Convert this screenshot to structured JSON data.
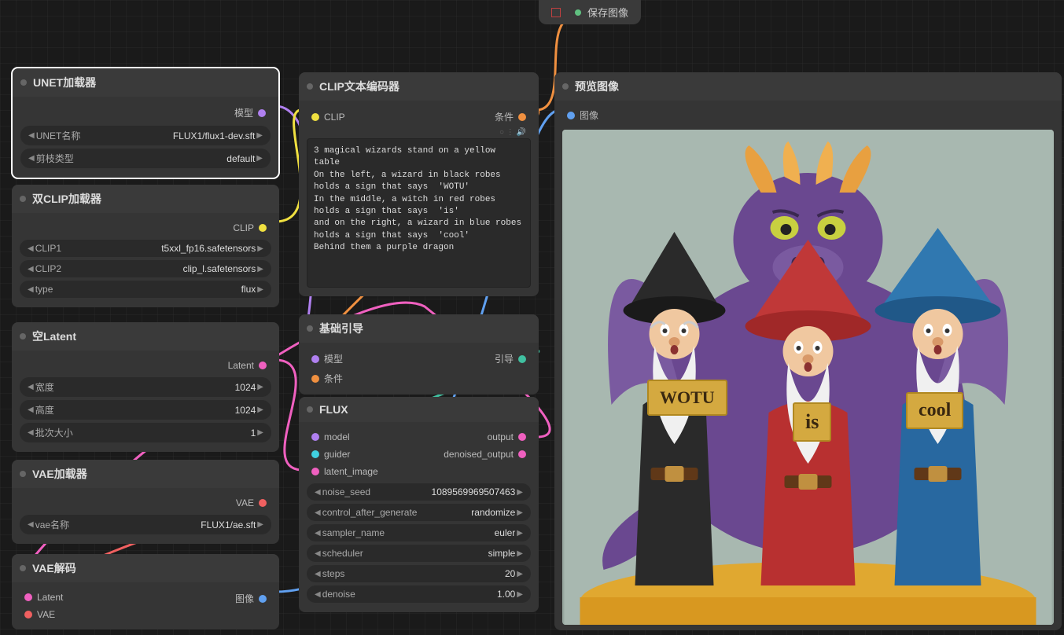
{
  "top_widget": {
    "label": "保存图像"
  },
  "nodes": {
    "unet": {
      "title": "UNET加载器",
      "out_port": "模型",
      "widgets": {
        "unet_name_label": "UNET名称",
        "unet_name_value": "FLUX1/flux1-dev.sft",
        "prune_label": "剪枝类型",
        "prune_value": "default"
      }
    },
    "dualclip": {
      "title": "双CLIP加载器",
      "out_port": "CLIP",
      "widgets": {
        "clip1_label": "CLIP1",
        "clip1_value": "t5xxl_fp16.safetensors",
        "clip2_label": "CLIP2",
        "clip2_value": "clip_l.safetensors",
        "type_label": "type",
        "type_value": "flux"
      }
    },
    "emptylatent": {
      "title": "空Latent",
      "out_port": "Latent",
      "widgets": {
        "width_label": "宽度",
        "width_value": "1024",
        "height_label": "高度",
        "height_value": "1024",
        "batch_label": "批次大小",
        "batch_value": "1"
      }
    },
    "vaeloader": {
      "title": "VAE加载器",
      "out_port": "VAE",
      "widgets": {
        "vae_label": "vae名称",
        "vae_value": "FLUX1/ae.sft"
      }
    },
    "vaedecode": {
      "title": "VAE解码",
      "in_latent": "Latent",
      "in_vae": "VAE",
      "out_image": "图像"
    },
    "clipencode": {
      "title": "CLIP文本编码器",
      "in_clip": "CLIP",
      "out_cond": "条件",
      "text": "3 magical wizards stand on a yellow table\nOn the left, a wizard in black robes holds a sign that says  'WOTU'\nIn the middle, a witch in red robes holds a sign that says  'is'\nand on the right, a wizard in blue robes holds a sign that says  'cool'\nBehind them a purple dragon"
    },
    "guidance": {
      "title": "基础引导",
      "in_model": "模型",
      "in_cond": "条件",
      "out_guide": "引导"
    },
    "flux": {
      "title": "FLUX",
      "in_model": "model",
      "in_guider": "guider",
      "in_latent": "latent_image",
      "out_output": "output",
      "out_denoised": "denoised_output",
      "widgets": {
        "seed_label": "noise_seed",
        "seed_value": "1089569969507463",
        "cag_label": "control_after_generate",
        "cag_value": "randomize",
        "sampler_label": "sampler_name",
        "sampler_value": "euler",
        "scheduler_label": "scheduler",
        "scheduler_value": "simple",
        "steps_label": "steps",
        "steps_value": "20",
        "denoise_label": "denoise",
        "denoise_value": "1.00"
      }
    },
    "preview": {
      "title": "预览图像",
      "in_image": "图像"
    }
  },
  "illustration": {
    "sign1": "WOTU",
    "sign2": "is",
    "sign3": "cool"
  }
}
